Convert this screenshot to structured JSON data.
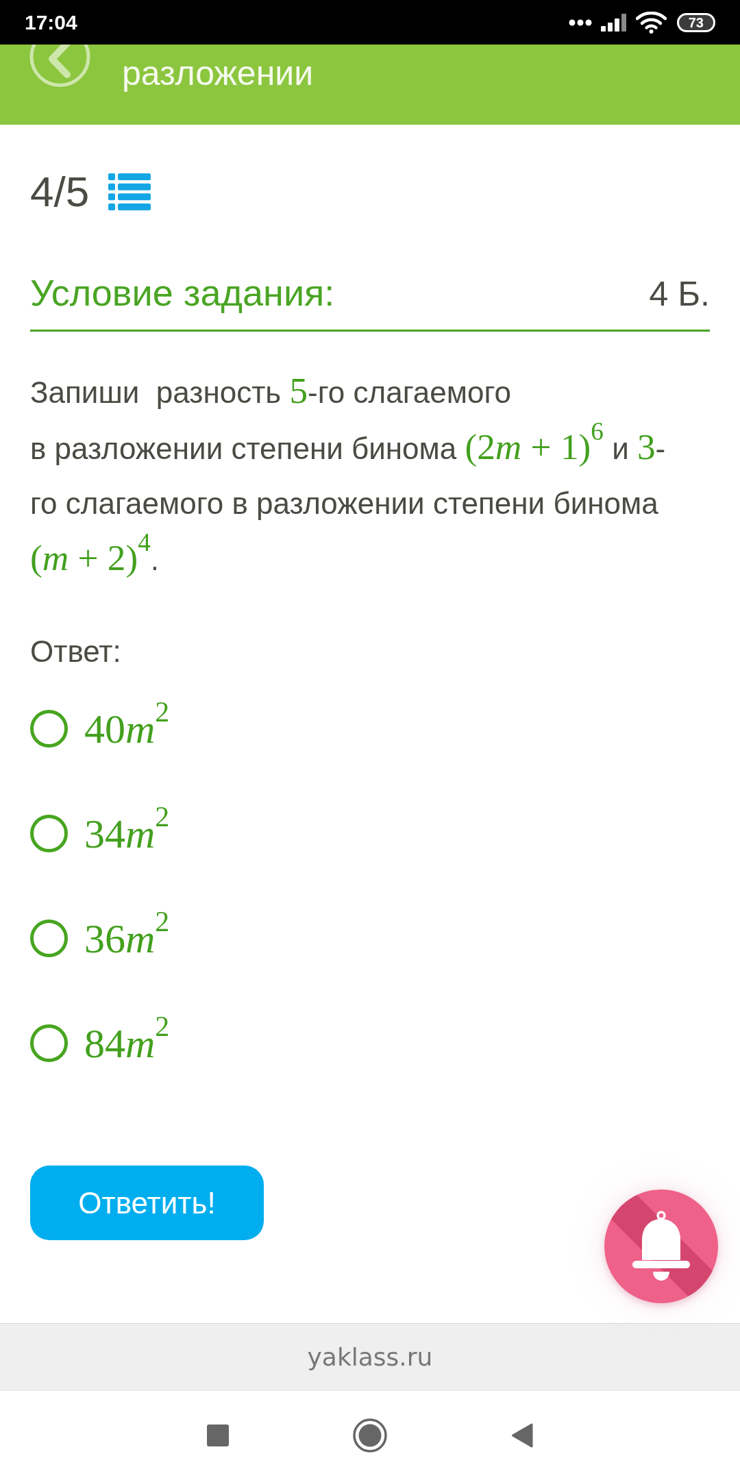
{
  "status_bar": {
    "time": "17:04",
    "battery": "73"
  },
  "header": {
    "title": "разложении"
  },
  "progress": {
    "counter": "4/5"
  },
  "task": {
    "heading": "Условие задания:",
    "points": "4 Б.",
    "question": [
      {
        "kind": "text",
        "text": "Запиши  разность "
      },
      {
        "kind": "math",
        "parts": [
          {
            "kind": "plain",
            "text": "5"
          }
        ]
      },
      {
        "kind": "text",
        "text": "-го слагаемого\nв разложении степени бинома "
      },
      {
        "kind": "math",
        "parts": [
          {
            "kind": "plain",
            "text": "(2"
          },
          {
            "kind": "var",
            "text": "m"
          },
          {
            "kind": "plain",
            "text": " + 1)"
          },
          {
            "kind": "sup",
            "text": "6"
          }
        ]
      },
      {
        "kind": "text",
        "text": " и "
      },
      {
        "kind": "math",
        "parts": [
          {
            "kind": "plain",
            "text": "3"
          }
        ]
      },
      {
        "kind": "text",
        "text": "-го слагаемого в разложении степени бинома "
      },
      {
        "kind": "math",
        "parts": [
          {
            "kind": "plain",
            "text": "("
          },
          {
            "kind": "var",
            "text": "m"
          },
          {
            "kind": "plain",
            "text": " + 2)"
          },
          {
            "kind": "sup",
            "text": "4"
          }
        ]
      },
      {
        "kind": "text",
        "text": "."
      }
    ],
    "answer_label": "Ответ:",
    "options": [
      {
        "parts": [
          {
            "kind": "plain",
            "text": "40"
          },
          {
            "kind": "var",
            "text": "m"
          },
          {
            "kind": "sup",
            "text": "2"
          }
        ],
        "selected": false
      },
      {
        "parts": [
          {
            "kind": "plain",
            "text": "34"
          },
          {
            "kind": "var",
            "text": "m"
          },
          {
            "kind": "sup",
            "text": "2"
          }
        ],
        "selected": false
      },
      {
        "parts": [
          {
            "kind": "plain",
            "text": "36"
          },
          {
            "kind": "var",
            "text": "m"
          },
          {
            "kind": "sup",
            "text": "2"
          }
        ],
        "selected": false
      },
      {
        "parts": [
          {
            "kind": "plain",
            "text": "84"
          },
          {
            "kind": "var",
            "text": "m"
          },
          {
            "kind": "sup",
            "text": "2"
          }
        ],
        "selected": false
      }
    ],
    "submit": "Ответить!"
  },
  "footer": {
    "site": "yaklass.ru"
  }
}
